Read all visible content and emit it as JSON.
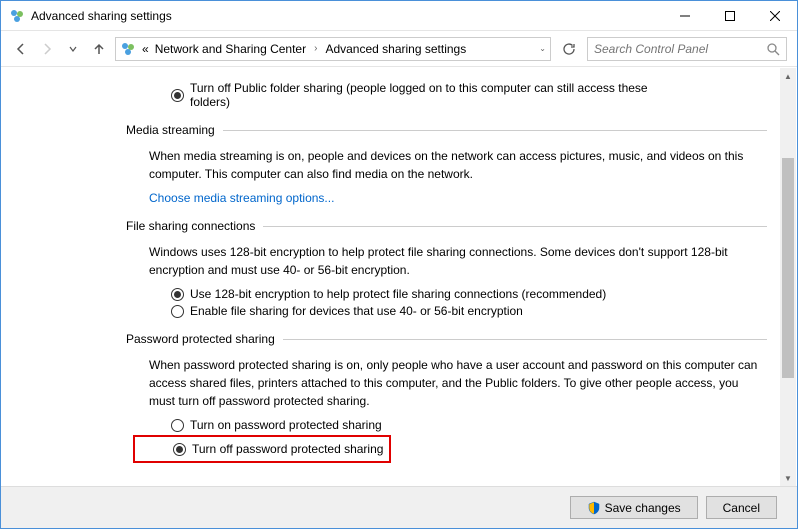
{
  "window": {
    "title": "Advanced sharing settings"
  },
  "breadcrumb": {
    "prefix": "«",
    "item1": "Network and Sharing Center",
    "item2": "Advanced sharing settings"
  },
  "search": {
    "placeholder": "Search Control Panel"
  },
  "publicFolder": {
    "radioOff": "Turn off Public folder sharing (people logged on to this computer can still access these folders)"
  },
  "mediaStreaming": {
    "title": "Media streaming",
    "desc": "When media streaming is on, people and devices on the network can access pictures, music, and videos on this computer. This computer can also find media on the network.",
    "link": "Choose media streaming options..."
  },
  "fileSharing": {
    "title": "File sharing connections",
    "desc": "Windows uses 128-bit encryption to help protect file sharing connections. Some devices don't support 128-bit encryption and must use 40- or 56-bit encryption.",
    "radio128": "Use 128-bit encryption to help protect file sharing connections (recommended)",
    "radio40": "Enable file sharing for devices that use 40- or 56-bit encryption"
  },
  "passwordSharing": {
    "title": "Password protected sharing",
    "desc": "When password protected sharing is on, only people who have a user account and password on this computer can access shared files, printers attached to this computer, and the Public folders. To give other people access, you must turn off password protected sharing.",
    "radioOn": "Turn on password protected sharing",
    "radioOff": "Turn off password protected sharing"
  },
  "footer": {
    "save": "Save changes",
    "cancel": "Cancel"
  }
}
